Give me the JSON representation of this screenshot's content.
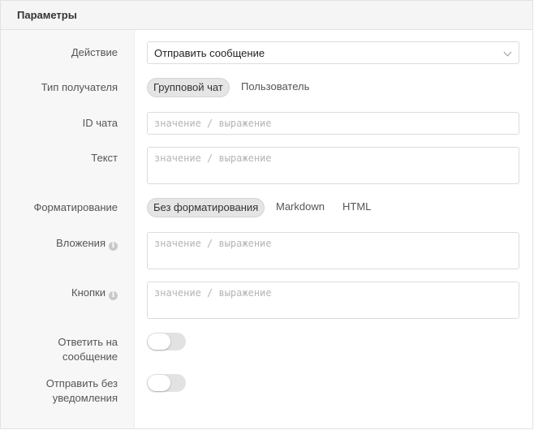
{
  "panel": {
    "title": "Параметры"
  },
  "action": {
    "label": "Действие",
    "value": "Отправить сообщение",
    "icon": "chevron-down-icon"
  },
  "recipient_type": {
    "label": "Тип получателя",
    "options": [
      "Групповой чат",
      "Пользователь"
    ],
    "selected": "Групповой чат"
  },
  "chat_id": {
    "label": "ID чата",
    "placeholder": "значение / выражение"
  },
  "text": {
    "label": "Текст",
    "placeholder": "значение / выражение"
  },
  "formatting": {
    "label": "Форматирование",
    "options": [
      "Без форматирования",
      "Markdown",
      "HTML"
    ],
    "selected": "Без форматирования"
  },
  "attachments": {
    "label": "Вложения",
    "placeholder": "значение / выражение",
    "info_icon": "info-icon"
  },
  "buttons": {
    "label": "Кнопки",
    "placeholder": "значение / выражение",
    "info_icon": "info-icon"
  },
  "reply": {
    "label_line1": "Ответить на",
    "label_line2": "сообщение",
    "enabled": false
  },
  "silent": {
    "label_line1": "Отправить без",
    "label_line2": "уведомления",
    "enabled": false
  },
  "colors": {
    "active_segment_bg": "#e5e5e5",
    "toggle_off_bg": "#e2e2e2",
    "header_bg": "#f5f5f5"
  }
}
